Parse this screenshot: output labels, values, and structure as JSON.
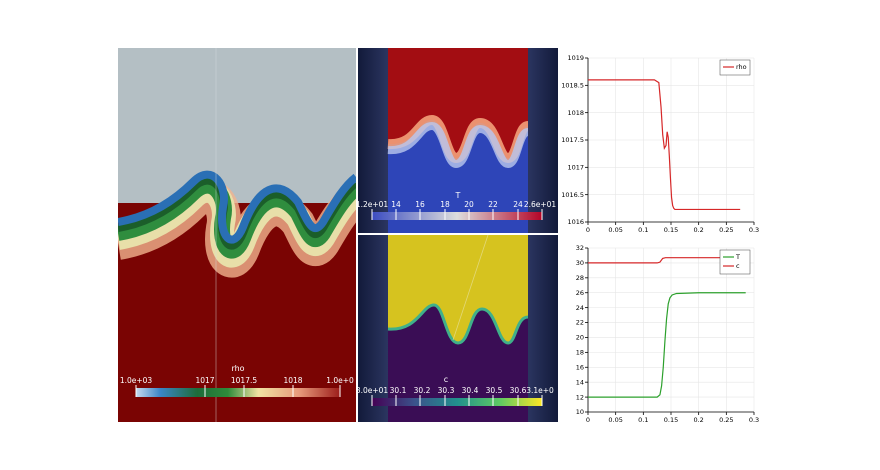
{
  "views": {
    "rho_view": {
      "colorbar": {
        "title": "rho",
        "ticks": [
          "1.0e+03",
          "1017",
          "1017.5",
          "1018",
          "1.0e+0"
        ]
      }
    },
    "t_view": {
      "colorbar": {
        "title": "T",
        "ticks": [
          "1.2e+01",
          "14",
          "16",
          "18",
          "20",
          "22",
          "24",
          "2.6e+01"
        ]
      }
    },
    "c_view": {
      "colorbar": {
        "title": "c",
        "ticks": [
          "3.0e+01",
          "30.1",
          "30.2",
          "30.3",
          "30.4",
          "30.5",
          "30.6",
          "3.1e+0"
        ]
      }
    }
  },
  "colors": {
    "background": "#b4bfc4",
    "dark_red": "#7a0403",
    "colormap_blue": "#3b4cc0",
    "colormap_red": "#b40426",
    "viridis_dark": "#440154",
    "viridis_yellow": "#dccd1e",
    "series_red": "#d62728",
    "series_green": "#2ca02c"
  },
  "chart_data": [
    {
      "type": "line",
      "title": "",
      "xlabel": "",
      "ylabel": "",
      "xlim": [
        0,
        0.3
      ],
      "ylim": [
        1016,
        1019
      ],
      "x_ticks": [
        "0",
        "0.05",
        "0.1",
        "0.15",
        "0.2",
        "0.25",
        "0.3"
      ],
      "y_ticks": [
        "1016",
        "1016.5",
        "1017",
        "1017.5",
        "1018",
        "1018.5",
        "1019"
      ],
      "legend_position": "top-right",
      "series": [
        {
          "name": "rho",
          "color": "#d62728",
          "x": [
            0,
            0.02,
            0.05,
            0.08,
            0.1,
            0.12,
            0.128,
            0.132,
            0.135,
            0.138,
            0.141,
            0.143,
            0.145,
            0.147,
            0.149,
            0.151,
            0.153,
            0.155,
            0.157,
            0.16,
            0.2,
            0.25,
            0.275
          ],
          "y": [
            1018.6,
            1018.6,
            1018.6,
            1018.6,
            1018.6,
            1018.6,
            1018.55,
            1018.1,
            1017.6,
            1017.35,
            1017.4,
            1017.65,
            1017.55,
            1017.2,
            1016.8,
            1016.45,
            1016.3,
            1016.25,
            1016.23,
            1016.23,
            1016.23,
            1016.23,
            1016.23
          ]
        }
      ]
    },
    {
      "type": "line",
      "title": "",
      "xlabel": "",
      "ylabel": "",
      "xlim": [
        0,
        0.3
      ],
      "ylim": [
        10,
        32
      ],
      "x_ticks": [
        "0",
        "0.05",
        "0.1",
        "0.15",
        "0.2",
        "0.25",
        "0.3"
      ],
      "y_ticks": [
        "10",
        "12",
        "14",
        "16",
        "18",
        "20",
        "22",
        "24",
        "26",
        "28",
        "30",
        "32"
      ],
      "legend_position": "top-right",
      "series": [
        {
          "name": "T",
          "color": "#2ca02c",
          "x": [
            0,
            0.05,
            0.1,
            0.125,
            0.13,
            0.133,
            0.136,
            0.139,
            0.142,
            0.145,
            0.148,
            0.152,
            0.16,
            0.2,
            0.25,
            0.285
          ],
          "y": [
            12,
            12,
            12,
            12,
            12.3,
            13.5,
            16,
            19.5,
            22.5,
            24.5,
            25.3,
            25.7,
            25.9,
            26,
            26,
            26
          ]
        },
        {
          "name": "c",
          "color": "#d62728",
          "x": [
            0,
            0.05,
            0.1,
            0.125,
            0.13,
            0.135,
            0.14,
            0.2,
            0.25,
            0.285
          ],
          "y": [
            30,
            30,
            30,
            30,
            30.1,
            30.6,
            30.7,
            30.7,
            30.7,
            30.7
          ]
        }
      ]
    }
  ]
}
